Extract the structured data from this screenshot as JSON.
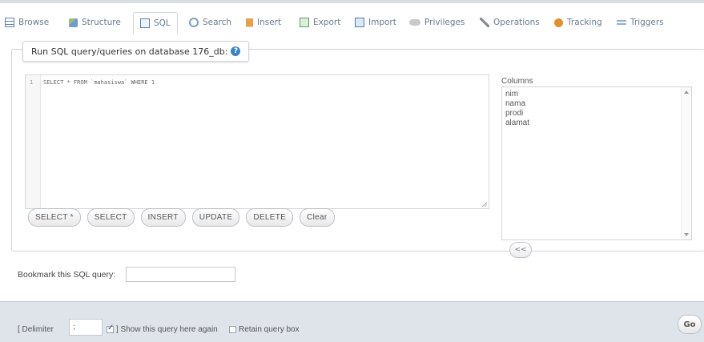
{
  "tabs": [
    {
      "label": "Browse",
      "icon": "table-grid-icon"
    },
    {
      "label": "Structure",
      "icon": "structure-icon"
    },
    {
      "label": "SQL",
      "icon": "sql-icon"
    },
    {
      "label": "Search",
      "icon": "search-icon"
    },
    {
      "label": "Insert",
      "icon": "insert-icon"
    },
    {
      "label": "Export",
      "icon": "export-icon"
    },
    {
      "label": "Import",
      "icon": "import-icon"
    },
    {
      "label": "Privileges",
      "icon": "privileges-icon"
    },
    {
      "label": "Operations",
      "icon": "operations-icon"
    },
    {
      "label": "Tracking",
      "icon": "tracking-icon"
    },
    {
      "label": "Triggers",
      "icon": "triggers-icon"
    }
  ],
  "query_box": {
    "legend": "Run SQL query/queries on database 176_db:",
    "line_number": "1",
    "sql": "SELECT * FROM `mahasiswa` WHERE 1",
    "buttons": [
      "SELECT *",
      "SELECT",
      "INSERT",
      "UPDATE",
      "DELETE",
      "Clear"
    ]
  },
  "columns_panel": {
    "label": "Columns",
    "items": [
      "nim",
      "nama",
      "prodi",
      "alamat"
    ],
    "insert_button": "<<"
  },
  "bookmark": {
    "label": "Bookmark this SQL query:",
    "value": ""
  },
  "footer": {
    "delimiter_label": "[ Delimiter",
    "delimiter_value": ";",
    "show_query_label": "] Show this query here again",
    "show_query_checked": true,
    "retain_label": "Retain query box",
    "retain_checked": false,
    "go_button": "Go"
  },
  "colors": {
    "footer_bg": "#dfe4ea",
    "link": "#6b7c8f",
    "help_icon": "#3a83c4"
  }
}
